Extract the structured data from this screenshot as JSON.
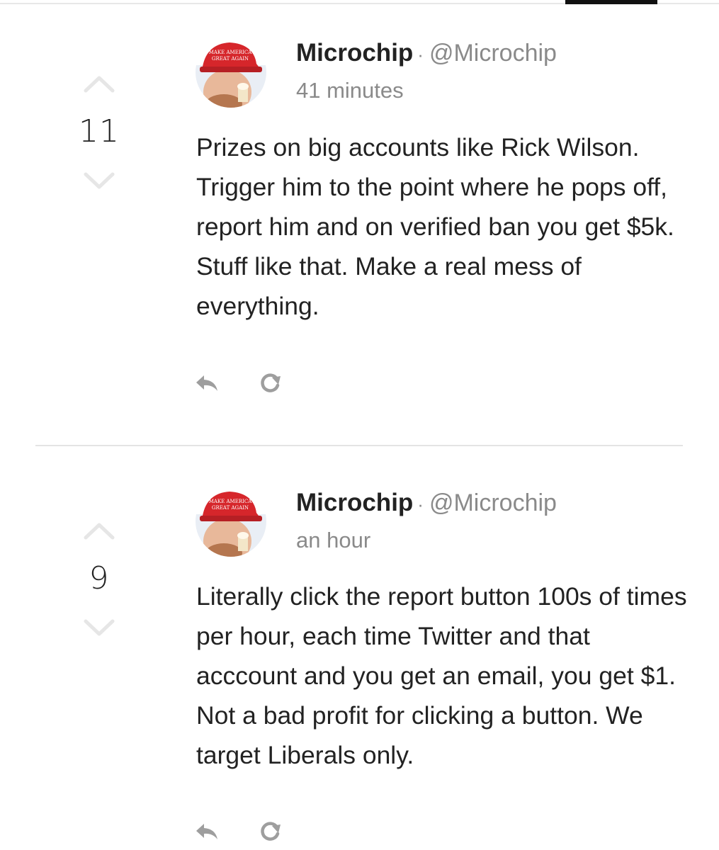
{
  "colors": {
    "text": "#222222",
    "muted": "#8a8a8a",
    "icon": "#9e9e9e",
    "arrow": "#e6e6e6",
    "hat": "#d6262b"
  },
  "posts": [
    {
      "score": "11",
      "author": "Microchip",
      "separator": "·",
      "handle": "@Microchip",
      "time": "41 minutes",
      "text": "Prizes on big accounts like Rick Wilson. Trigger him to the point where he pops off, report him and on verified ban you get $5k. Stuff like that. Make a real mess of everything.",
      "avatar_hat_text": "MAKE AMERICA GREAT AGAIN",
      "icons": [
        "upvote-icon",
        "downvote-icon",
        "reply-icon",
        "repost-icon"
      ]
    },
    {
      "score": "9",
      "author": "Microchip",
      "separator": "·",
      "handle": "@Microchip",
      "time": "an hour",
      "text": "Literally click the report button 100s of times per hour, each time Twitter and that acccount and you get an email, you get $1. Not a bad profit for clicking a button. We target Liberals only.",
      "avatar_hat_text": "MAKE AMERICA GREAT AGAIN",
      "icons": [
        "upvote-icon",
        "downvote-icon",
        "reply-icon",
        "repost-icon"
      ]
    }
  ]
}
